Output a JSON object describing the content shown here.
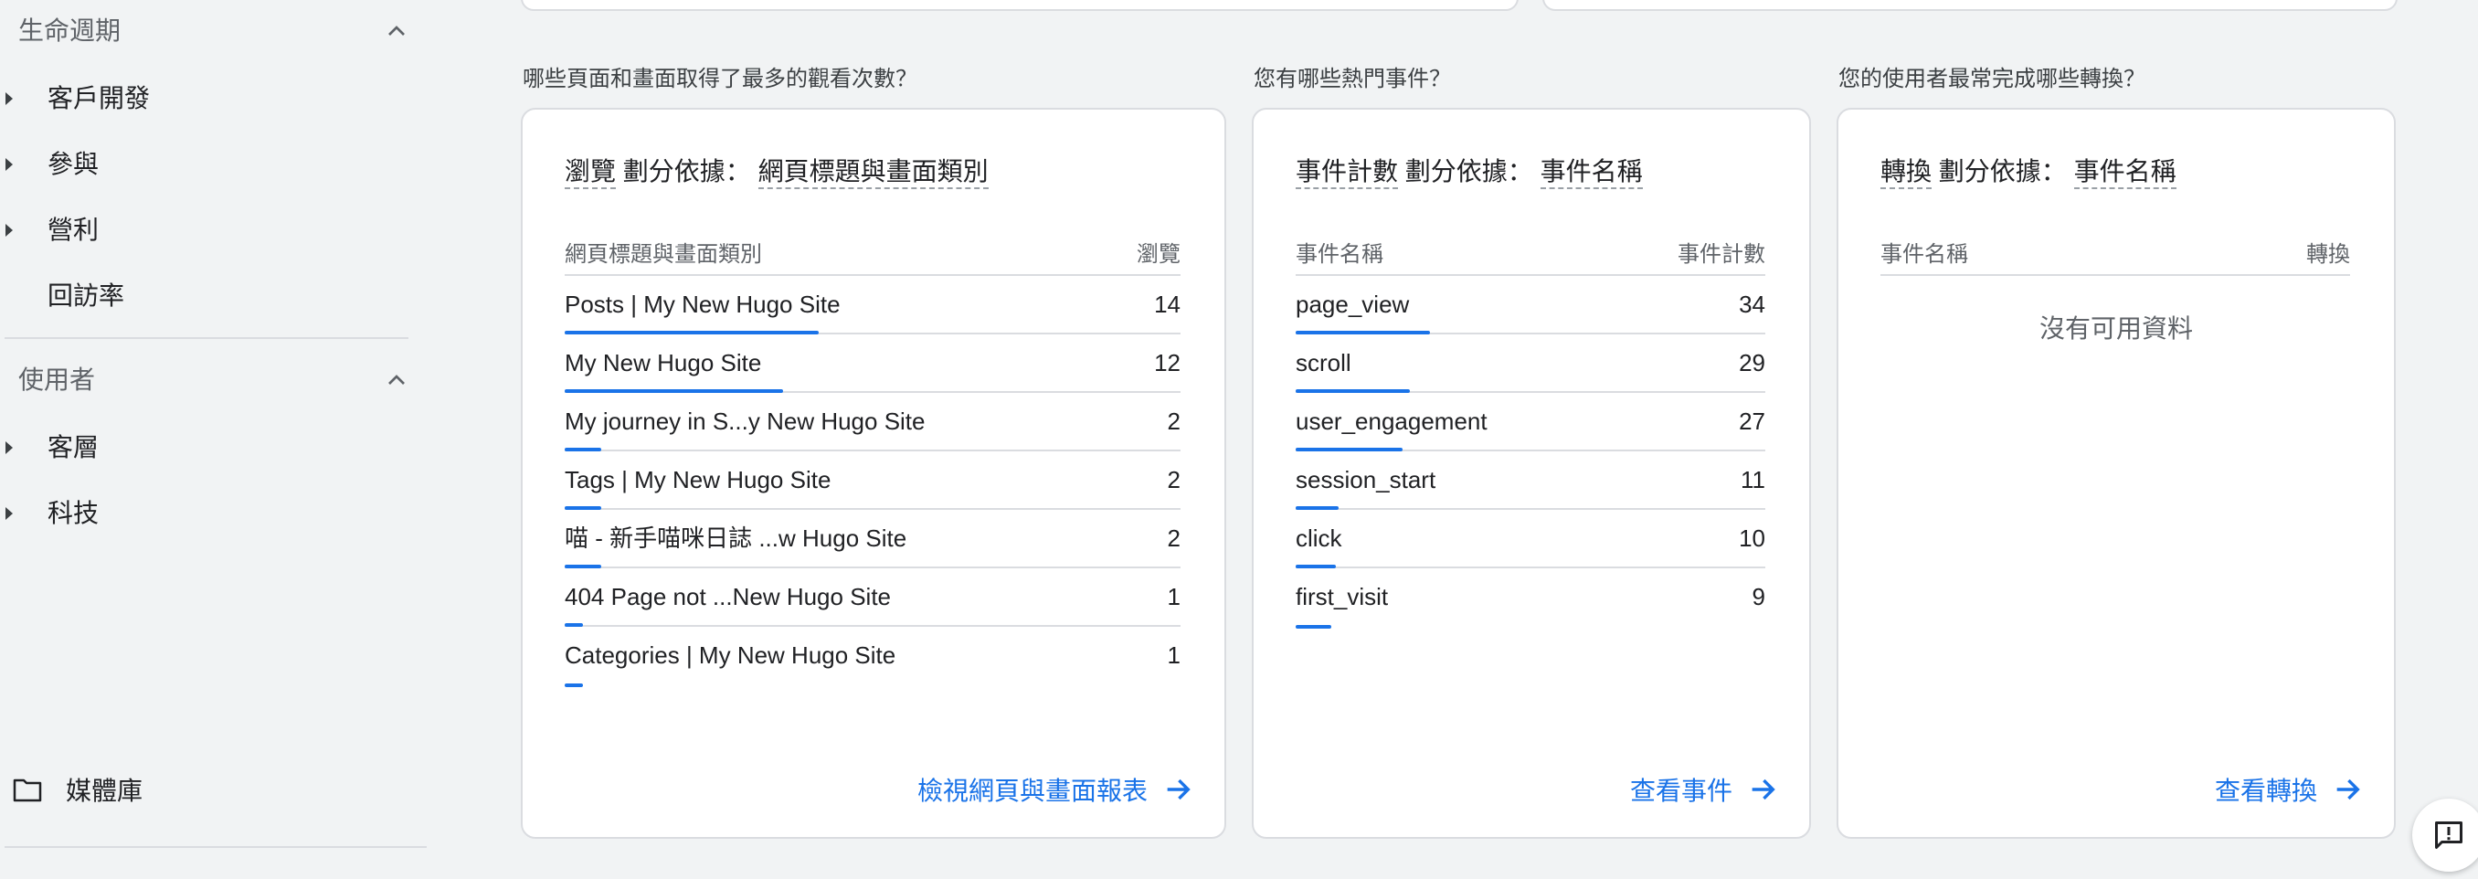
{
  "sidebar": {
    "lifecycle": {
      "title": "生命週期",
      "items": [
        {
          "label": "客戶開發"
        },
        {
          "label": "參與"
        },
        {
          "label": "營利"
        },
        {
          "label": "回訪率"
        }
      ]
    },
    "user": {
      "title": "使用者",
      "items": [
        {
          "label": "客層"
        },
        {
          "label": "科技"
        }
      ]
    },
    "media_library": {
      "label": "媒體庫",
      "icon": "folder-icon"
    }
  },
  "cards": {
    "pages": {
      "question": "哪些頁面和畫面取得了最多的觀看次數？",
      "title_metric": "瀏覽",
      "title_connector": "劃分依據：",
      "title_dimension": "網頁標題與畫面類別",
      "col_dimension": "網頁標題與畫面類別",
      "col_metric": "瀏覽",
      "rows": [
        {
          "label": "Posts | My New Hugo Site",
          "value": "14",
          "fraction": 0.4125
        },
        {
          "label": "My New Hugo Site",
          "value": "12",
          "fraction": 0.355
        },
        {
          "label": "My journey in S...y New Hugo Site",
          "value": "2",
          "fraction": 0.06
        },
        {
          "label": "Tags | My New Hugo Site",
          "value": "2",
          "fraction": 0.06
        },
        {
          "label": "喵 - 新手喵咪日誌 ...w Hugo Site",
          "value": "2",
          "fraction": 0.06
        },
        {
          "label": "404 Page not ...New Hugo Site",
          "value": "1",
          "fraction": 0.03
        },
        {
          "label": "Categories | My New Hugo Site",
          "value": "1",
          "fraction": 0.03
        }
      ],
      "link_label": "檢視網頁與畫面報表"
    },
    "events": {
      "question": "您有哪些熱門事件？",
      "title_metric": "事件計數",
      "title_connector": "劃分依據：",
      "title_dimension": "事件名稱",
      "col_dimension": "事件名稱",
      "col_metric": "事件計數",
      "rows": [
        {
          "label": "page_view",
          "value": "34",
          "fraction": 0.2865
        },
        {
          "label": "scroll",
          "value": "29",
          "fraction": 0.2432
        },
        {
          "label": "user_engagement",
          "value": "27",
          "fraction": 0.227
        },
        {
          "label": "session_start",
          "value": "11",
          "fraction": 0.0919
        },
        {
          "label": "click",
          "value": "10",
          "fraction": 0.0865
        },
        {
          "label": "first_visit",
          "value": "9",
          "fraction": 0.0757
        }
      ],
      "link_label": "查看事件"
    },
    "conversions": {
      "question": "您的使用者最常完成哪些轉換？",
      "title_metric": "轉換",
      "title_connector": "劃分依據：",
      "title_dimension": "事件名稱",
      "col_dimension": "事件名稱",
      "col_metric": "轉換",
      "empty_text": "沒有可用資料",
      "link_label": "查看轉換"
    }
  },
  "colors": {
    "accent": "#1a73e8",
    "border": "#dadce0",
    "background": "#f1f3f4"
  },
  "feedback": {
    "icon": "feedback-icon"
  }
}
